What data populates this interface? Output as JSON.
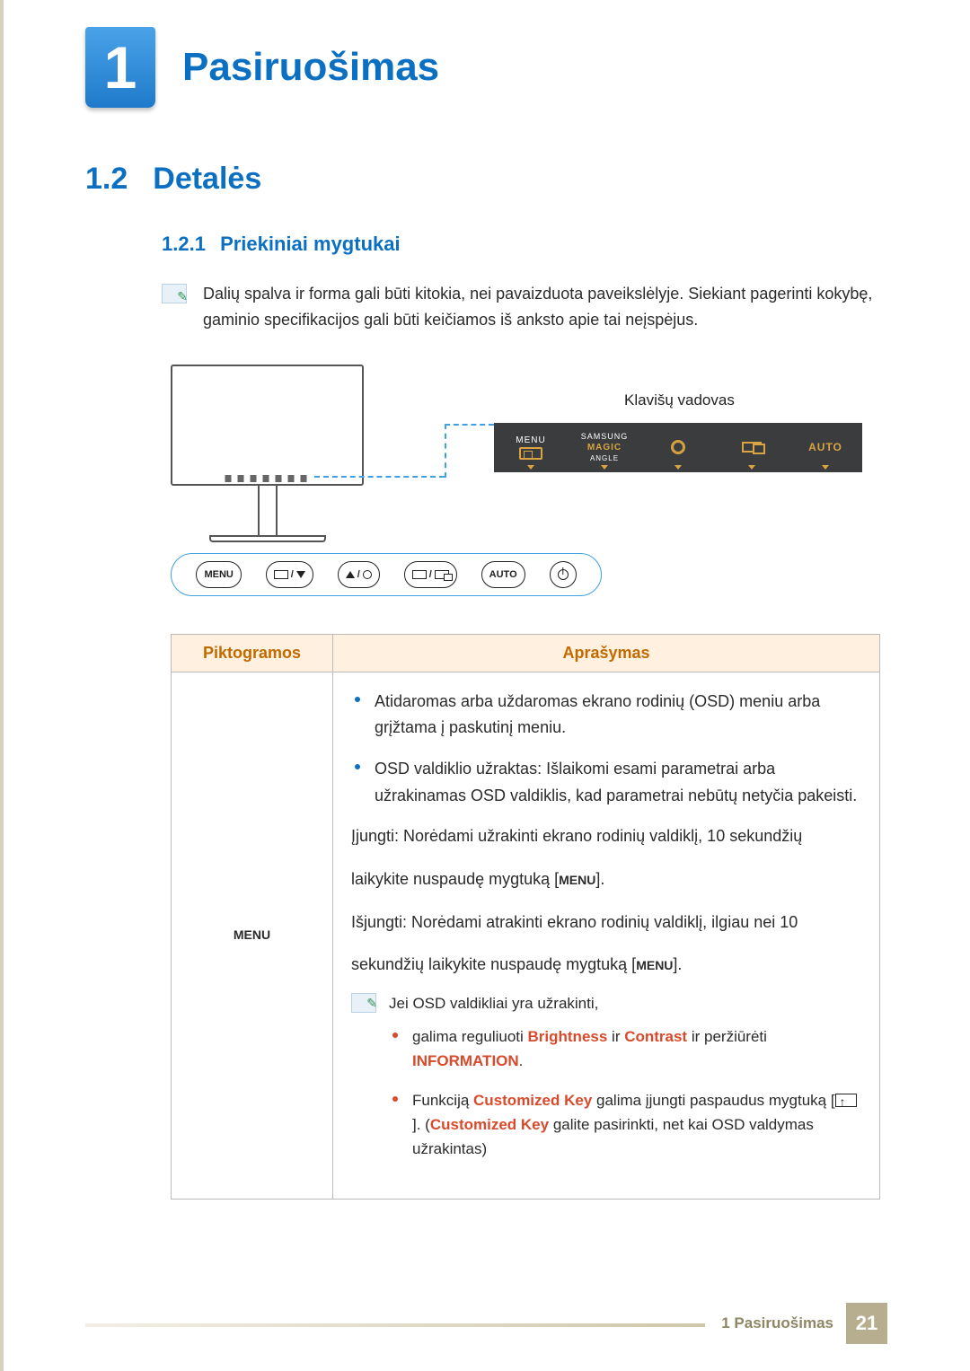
{
  "chapter": {
    "number": "1",
    "title": "Pasiruošimas"
  },
  "section": {
    "number": "1.2",
    "title": "Detalės"
  },
  "subsection": {
    "number": "1.2.1",
    "title": "Priekiniai mygtukai"
  },
  "intro_note": "Dalių spalva ir forma gali būti kitokia, nei pavaizduota paveikslėlyje. Siekiant pagerinti kokybę, gaminio specifikacijos gali būti keičiamos iš anksto apie tai neįspėjus.",
  "diagram": {
    "key_guide_label": "Klavišų vadovas",
    "osd_strip": {
      "menu": "MENU",
      "samsung": "SAMSUNG",
      "magic": "MAGIC",
      "angle": "ANGLE",
      "auto": "AUTO"
    },
    "button_row": {
      "menu": "MENU",
      "auto": "AUTO"
    }
  },
  "table": {
    "headers": {
      "icons": "Piktogramos",
      "description": "Aprašymas"
    },
    "row_menu": {
      "icon_label": "MENU",
      "b1": "Atidaromas arba uždaromas ekrano rodinių (OSD) meniu arba grįžtama į paskutinį meniu.",
      "b2": "OSD valdiklio užraktas: Išlaikomi esami parametrai arba užrakinamas OSD valdiklis, kad parametrai nebūtų netyčia pakeisti.",
      "p1a": "Įjungti: Norėdami užrakinti ekrano rodinių valdiklį, 10 sekundžių",
      "p1b_pre": "laikykite nuspaudę mygtuką [",
      "p1b_menu": "MENU",
      "p1b_post": "].",
      "p2a": "Išjungti: Norėdami atrakinti ekrano rodinių valdiklį, ilgiau nei 10",
      "p2b_pre": "sekundžių laikykite nuspaudę mygtuką [",
      "p2b_menu": "MENU",
      "p2b_post": "].",
      "subnote_intro": "Jei OSD valdikliai yra užrakinti,",
      "s1_pre": "galima reguliuoti ",
      "s1_b": "Brightness",
      "s1_mid": " ir ",
      "s1_c": "Contrast",
      "s1_post": " ir peržiūrėti ",
      "s1_info": "INFORMATION",
      "s1_end": ".",
      "s2_pre": "Funkciją ",
      "s2_ck1": "Customized Key",
      "s2_mid": " galima įjungti paspaudus mygtuką [",
      "s2_post": "]. (",
      "s2_ck2": "Customized Key",
      "s2_tail": " galite pasirinkti, net kai OSD valdymas užrakintas)"
    }
  },
  "footer": {
    "crumb": "1 Pasiruošimas",
    "page": "21"
  }
}
